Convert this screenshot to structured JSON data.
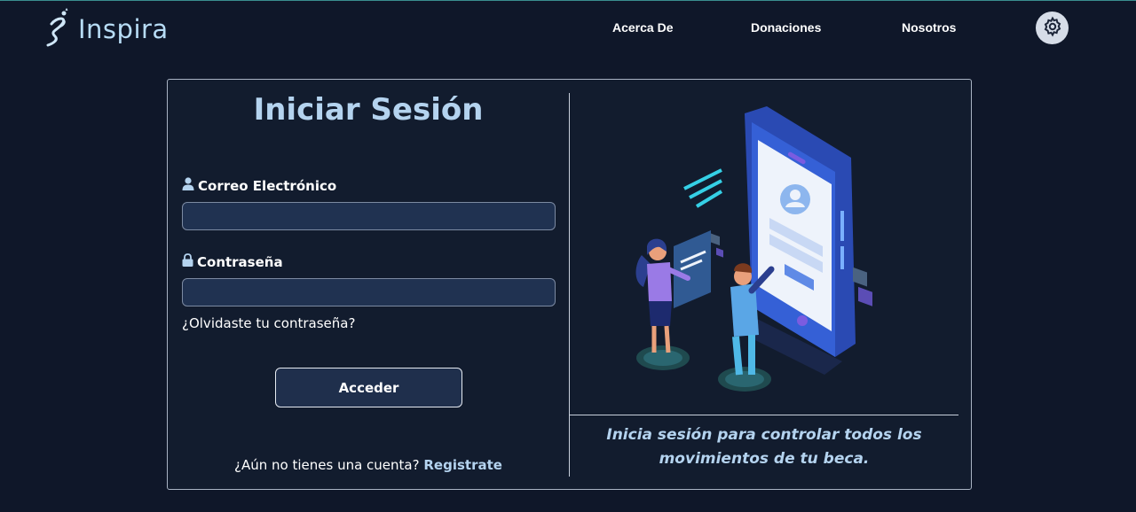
{
  "brand": {
    "name": "Inspira"
  },
  "nav": {
    "links": [
      "Acerca De",
      "Donaciones",
      "Nosotros"
    ],
    "settings_icon": "gear-icon"
  },
  "login": {
    "title": "Iniciar Sesión",
    "email_label": "Correo Electrónico",
    "email_icon": "user-icon",
    "email_value": "",
    "password_label": "Contraseña",
    "password_icon": "lock-icon",
    "password_value": "",
    "forgot_link": "¿Olvidaste tu contraseña?",
    "submit_label": "Acceder",
    "register_prompt": "¿Aún no tienes una cuenta?",
    "register_link": "Registrate"
  },
  "promo": {
    "caption_line1": "Inicia sesión para controlar todos los",
    "caption_line2": "movimientos de tu beca."
  },
  "colors": {
    "background": "#0f1729",
    "accent": "#b4d3ef",
    "input": "#203251"
  }
}
